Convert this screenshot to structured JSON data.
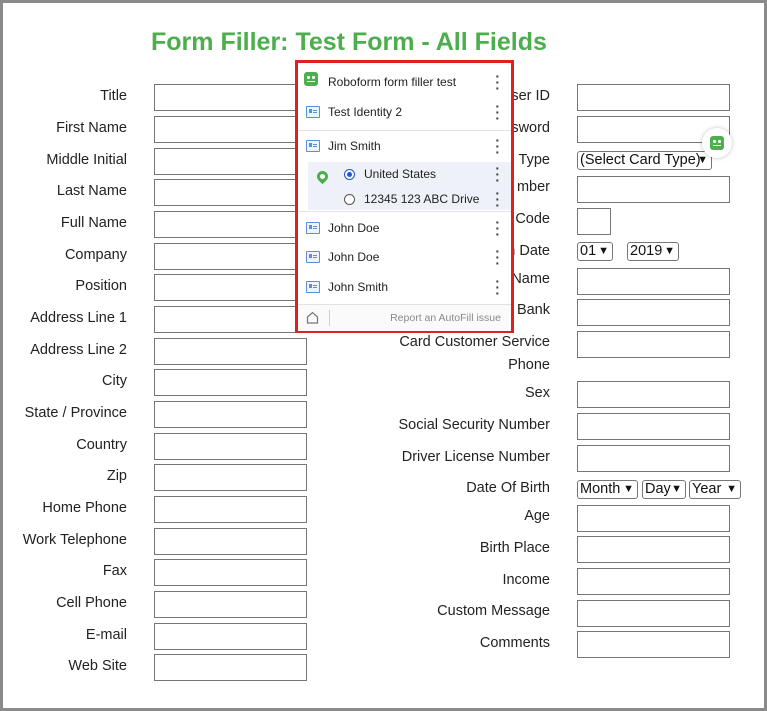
{
  "page": {
    "title": "Form Filler: Test Form - All Fields"
  },
  "left_fields": [
    {
      "label": "Title"
    },
    {
      "label": "First Name"
    },
    {
      "label": "Middle Initial"
    },
    {
      "label": "Last Name"
    },
    {
      "label": "Full Name"
    },
    {
      "label": "Company"
    },
    {
      "label": "Position"
    },
    {
      "label": "Address Line 1"
    },
    {
      "label": "Address Line 2"
    },
    {
      "label": "City"
    },
    {
      "label": "State / Province"
    },
    {
      "label": "Country"
    },
    {
      "label": "Zip"
    },
    {
      "label": "Home Phone"
    },
    {
      "label": "Work Telephone"
    },
    {
      "label": "Fax"
    },
    {
      "label": "Cell Phone"
    },
    {
      "label": "E-mail"
    },
    {
      "label": "Web Site"
    }
  ],
  "right_fields": {
    "user_id": "ser ID",
    "password": "sword",
    "card_type": "d Type",
    "card_number": "mber",
    "code": "Code",
    "exp_date": "n Date",
    "name": "Name",
    "bank": "Bank",
    "card_service_line1": "Card Customer Service",
    "card_service_line2": "Phone",
    "sex": "Sex",
    "ssn": "Social Security Number",
    "dl": "Driver License Number",
    "dob": "Date Of Birth",
    "age": "Age",
    "birth_place": "Birth Place",
    "income": "Income",
    "custom_message": "Custom Message",
    "comments": "Comments"
  },
  "selects": {
    "card_type": "(Select Card Type)",
    "exp_month": "01",
    "exp_year": "2019",
    "dob_month": "Month",
    "dob_day": "Day",
    "dob_year": "Year"
  },
  "popup": {
    "items": [
      {
        "label": "Roboform form filler test",
        "icon": "roboform-icon"
      },
      {
        "label": "Test Identity 2",
        "icon": "identity-card-icon"
      },
      {
        "label": "Jim Smith",
        "icon": "identity-card-icon"
      }
    ],
    "sub_options": [
      {
        "label": "United States",
        "selected": true
      },
      {
        "label": "12345 123 ABC Drive",
        "selected": false
      }
    ],
    "more_items": [
      {
        "label": "John Doe",
        "icon": "identity-card-icon"
      },
      {
        "label": "John Doe",
        "icon": "identity-card-icon"
      },
      {
        "label": "John Smith",
        "icon": "identity-card-icon"
      }
    ],
    "report_link": "Report an AutoFill issue"
  },
  "colors": {
    "title": "#4cae4c",
    "popup_border": "#e02020",
    "radio": "#1a56d6"
  }
}
